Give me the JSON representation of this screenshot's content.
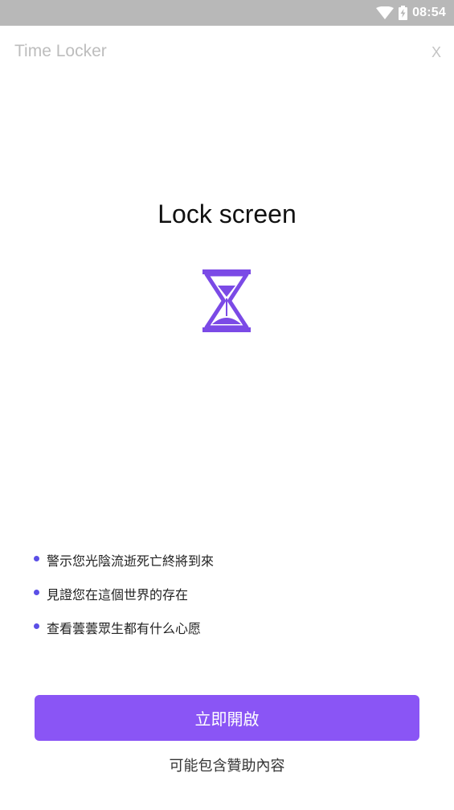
{
  "status_bar": {
    "time": "08:54",
    "icons": [
      "wifi-icon",
      "battery-charging-icon"
    ]
  },
  "header": {
    "title": "Time Locker",
    "close_label": "X"
  },
  "main": {
    "headline": "Lock screen",
    "hero_icon": "hourglass-icon",
    "features": [
      "警示您光陰流逝死亡終將到來",
      "見證您在這個世界的存在",
      "查看蕓蕓眾生都有什么心愿"
    ]
  },
  "footer": {
    "start_button_label": "立即開啟",
    "sponsor_note": "可能包含贊助內容"
  },
  "colors": {
    "accent": "#8a55f5",
    "icon_purple": "#7b4ae6",
    "bullet": "#5b4fe6",
    "status_bar": "#b8b8b8"
  }
}
